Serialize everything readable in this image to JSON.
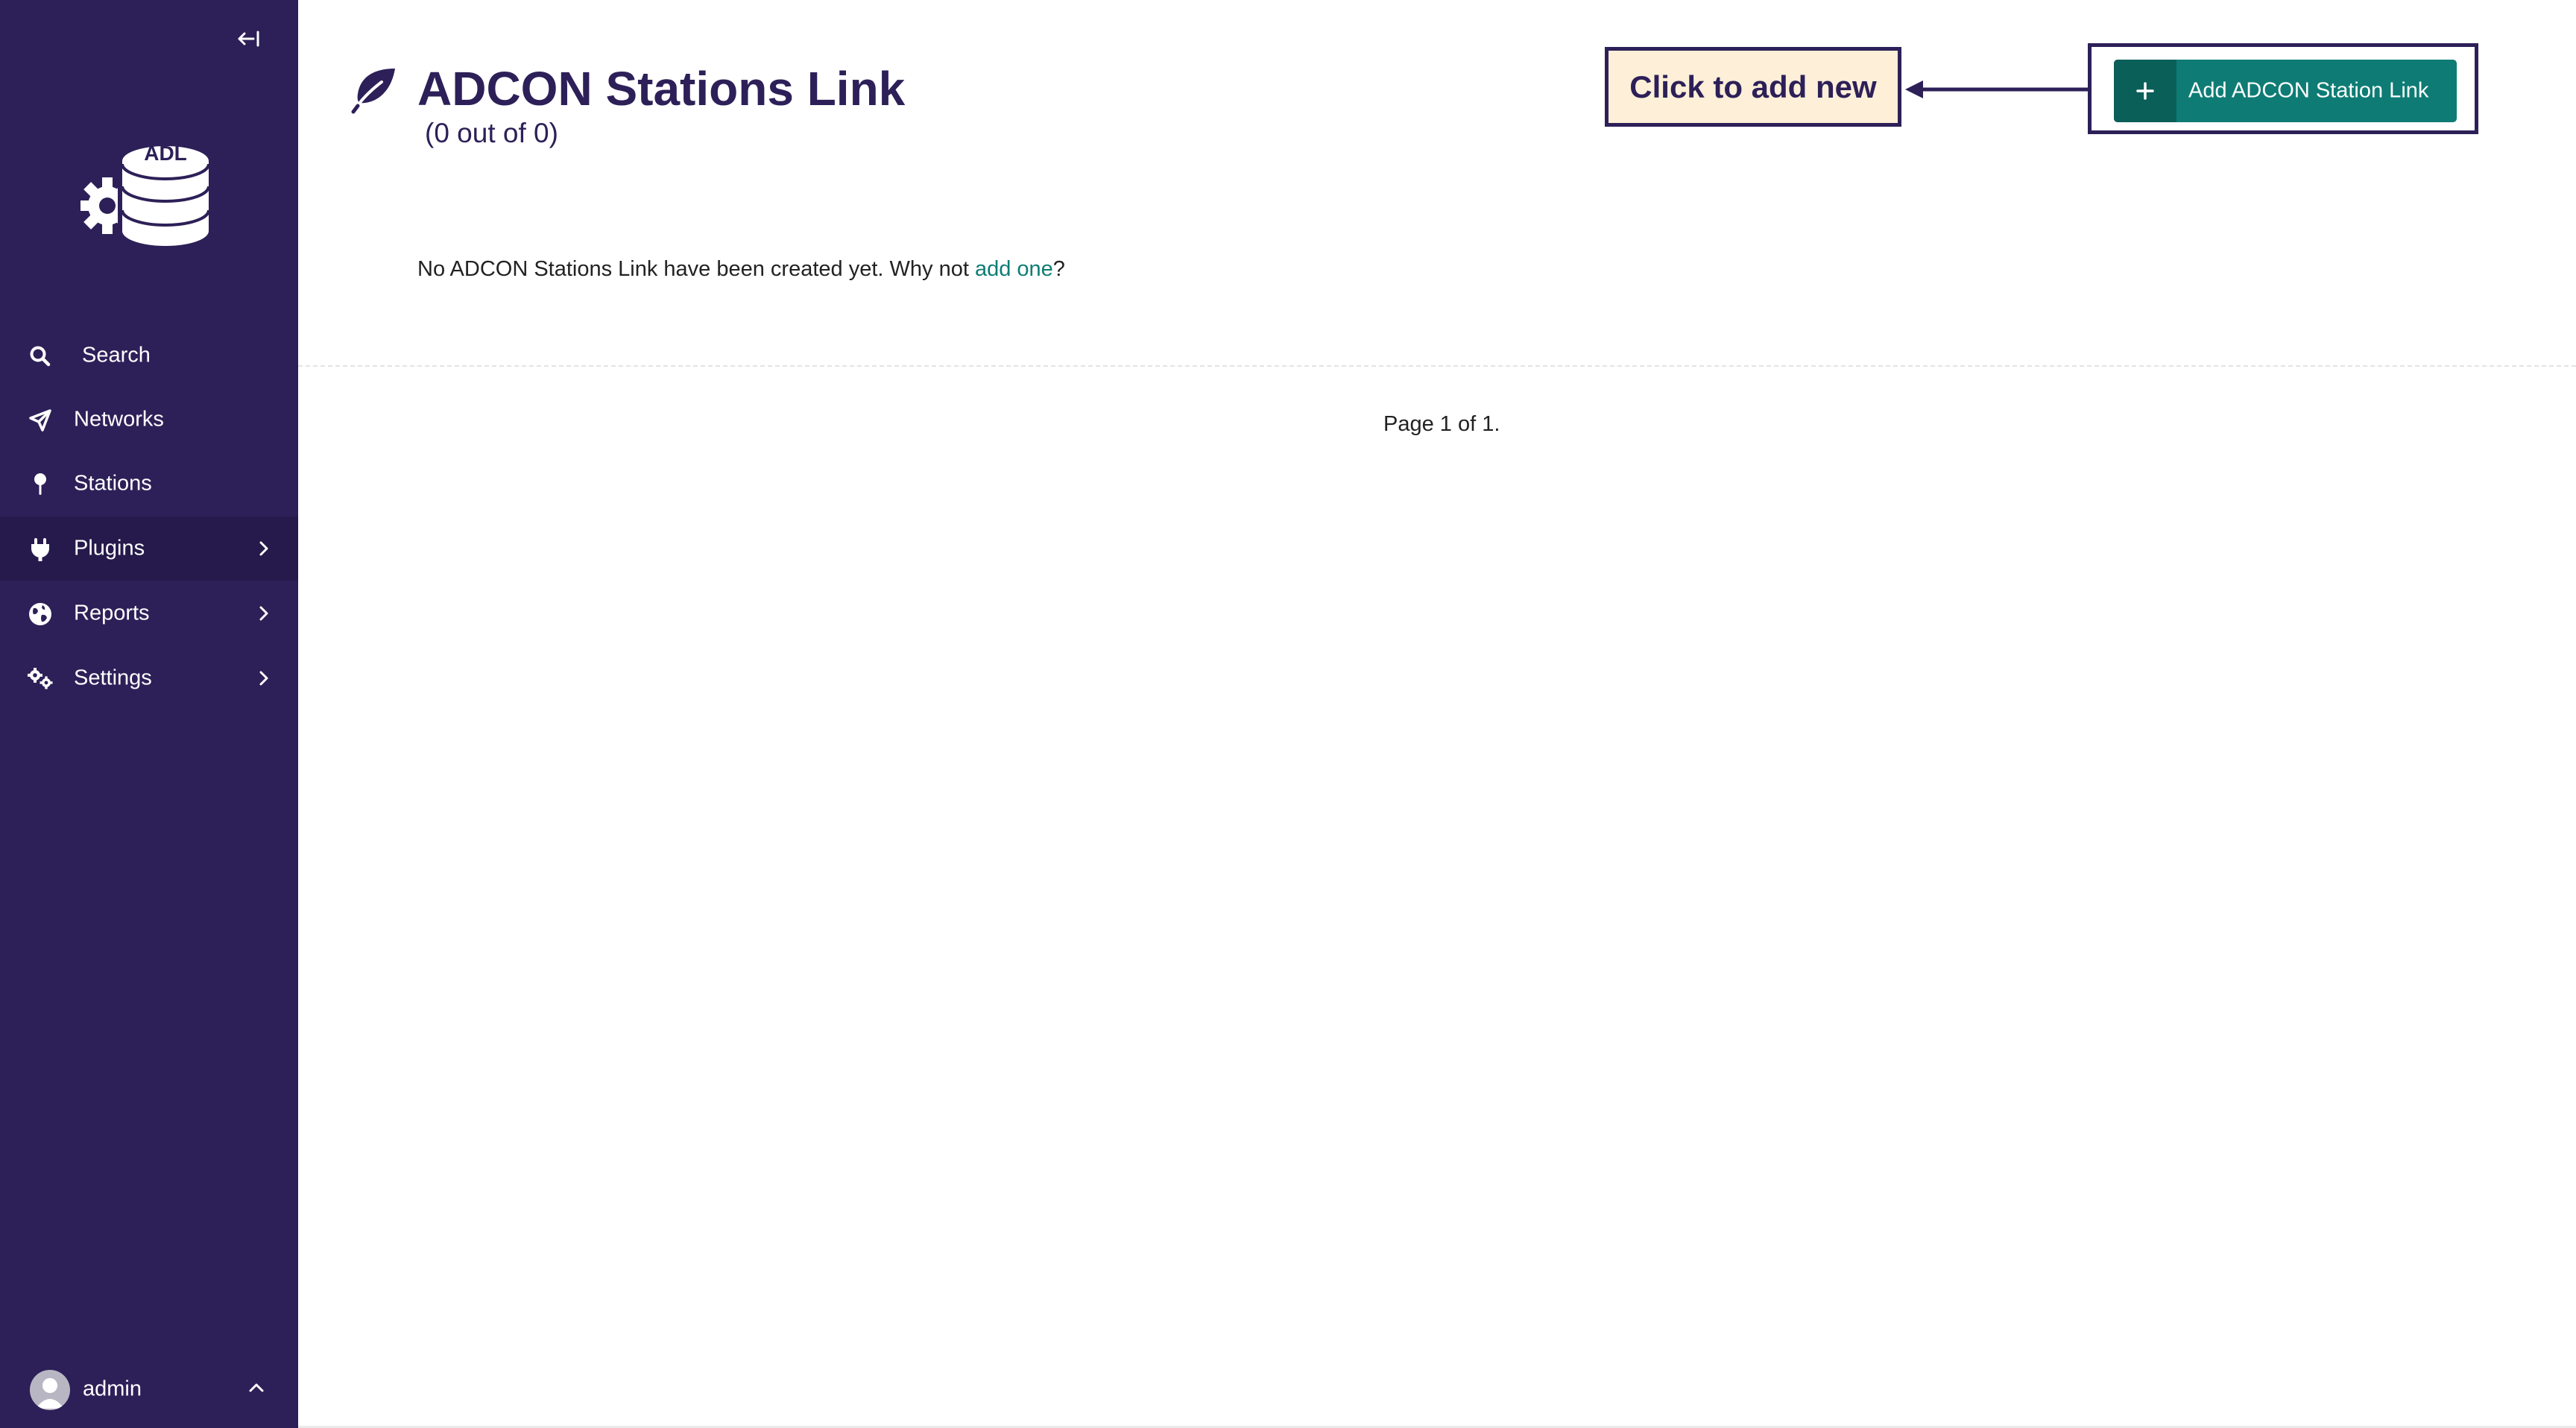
{
  "sidebar": {
    "logo_text": "ADL",
    "items": [
      {
        "label": "Search",
        "icon": "search-icon"
      },
      {
        "label": "Networks",
        "icon": "send-icon"
      },
      {
        "label": "Stations",
        "icon": "map-pin-icon"
      },
      {
        "label": "Plugins",
        "icon": "plug-icon",
        "has_submenu": true,
        "active": true
      },
      {
        "label": "Reports",
        "icon": "globe-icon",
        "has_submenu": true
      },
      {
        "label": "Settings",
        "icon": "gears-icon",
        "has_submenu": true
      }
    ],
    "user": {
      "name": "admin"
    }
  },
  "header": {
    "title": "ADCON Stations Link",
    "count": "(0 out of 0)",
    "add_button_label": "Add ADCON Station Link",
    "callout_text": "Click to add new"
  },
  "content": {
    "empty_prefix": "No ADCON Stations Link have been created yet. Why not ",
    "empty_link": "add one",
    "empty_suffix": "?",
    "pagination": "Page 1 of 1."
  },
  "colors": {
    "sidebar_bg": "#2d2058",
    "sidebar_active_bg": "#251a4b",
    "accent": "#0e7c74",
    "accent_dark": "#0b5f59",
    "callout_bg": "#fdefd8",
    "title": "#2d2058"
  }
}
